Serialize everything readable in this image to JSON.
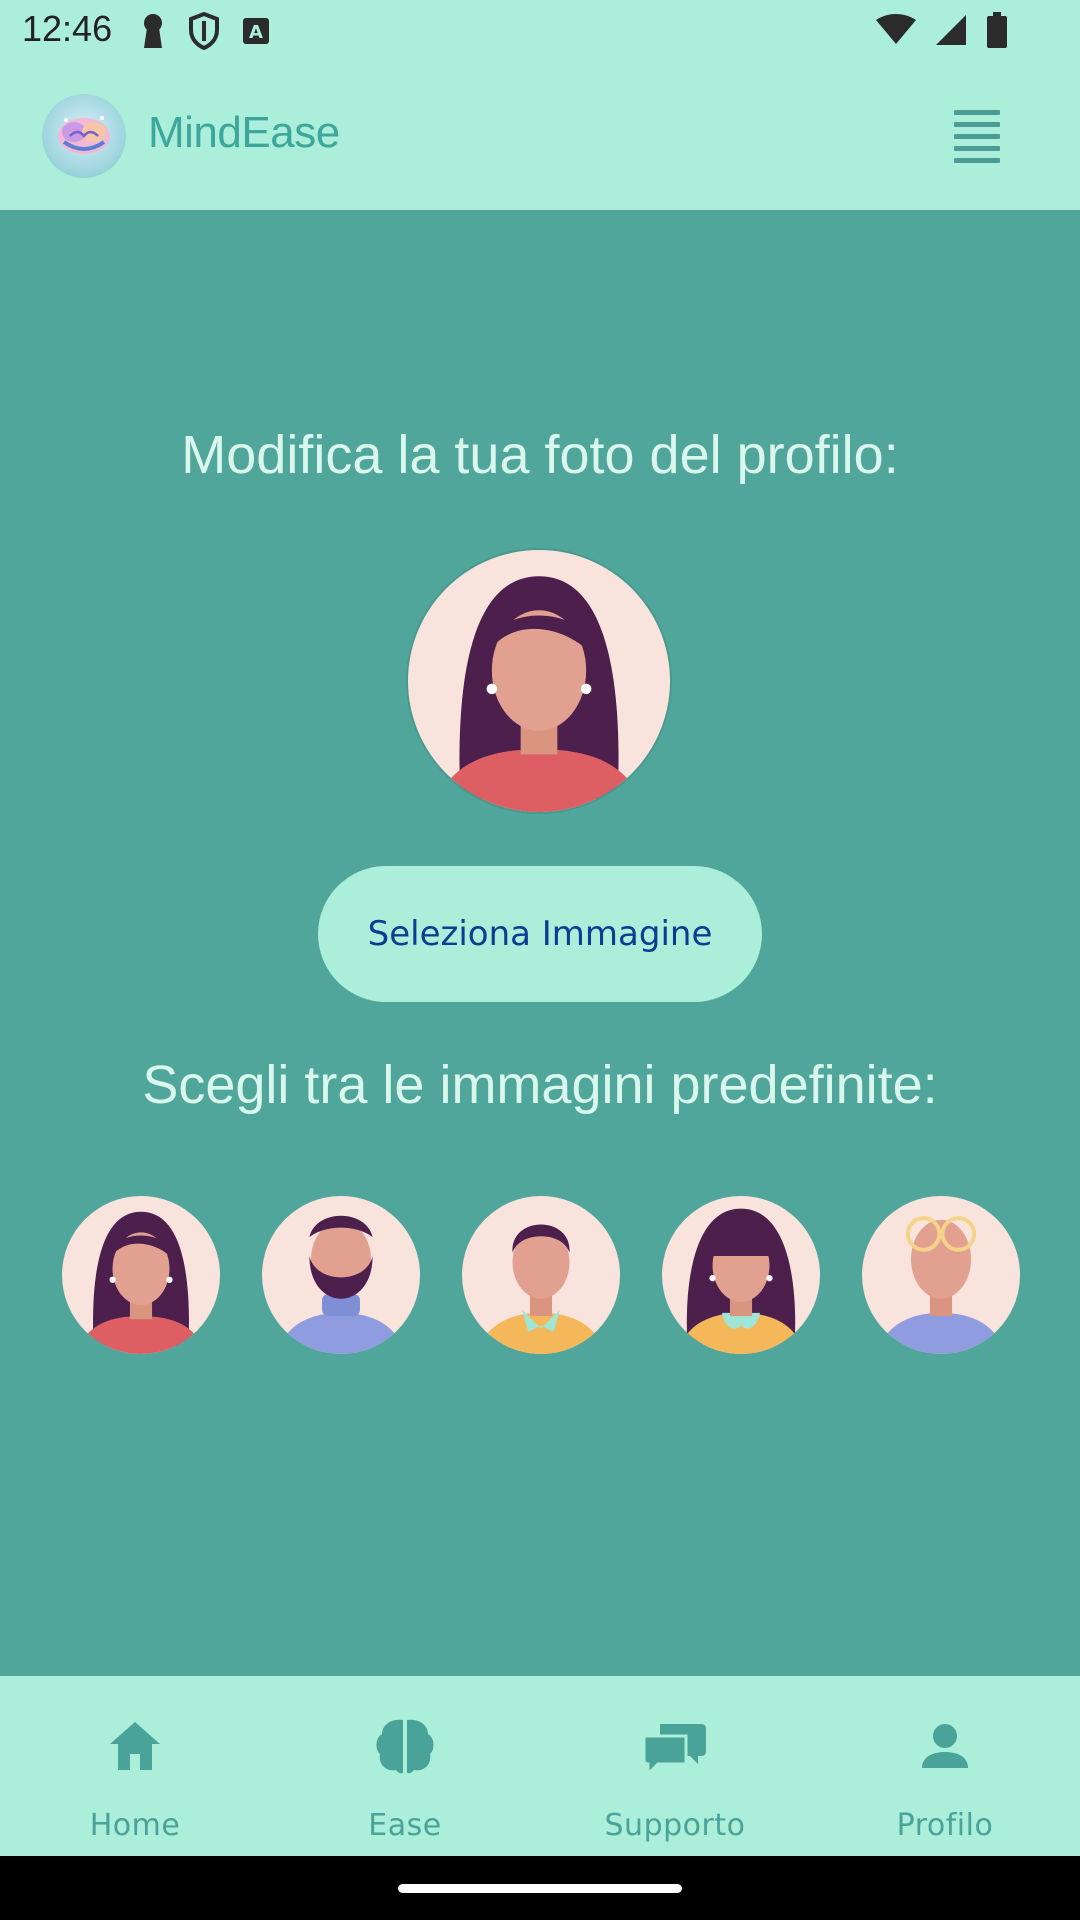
{
  "status_bar": {
    "time": "12:46",
    "left_icons": [
      "keyhole-icon",
      "shield-icon",
      "a-badge-icon"
    ],
    "right_icons": [
      "wifi-icon",
      "signal-icon",
      "battery-icon"
    ]
  },
  "app_bar": {
    "title": "MindEase",
    "logo_icon": "brain-logo-icon",
    "menu_icon": "menu-icon"
  },
  "main": {
    "heading_profile": "Modifica la tua foto del profilo:",
    "select_button_label": "Seleziona Immagine",
    "heading_presets": "Scegli tra le immagini predefinite:",
    "presets": [
      {
        "name": "woman-red-shirt"
      },
      {
        "name": "man-beard"
      },
      {
        "name": "man-yellow-collar"
      },
      {
        "name": "woman-yellow-collar"
      },
      {
        "name": "man-glasses"
      }
    ]
  },
  "bottom_nav": {
    "items": [
      {
        "label": "Home",
        "icon": "home-icon"
      },
      {
        "label": "Ease",
        "icon": "brain-icon"
      },
      {
        "label": "Supporto",
        "icon": "chat-icon"
      },
      {
        "label": "Profilo",
        "icon": "person-icon"
      }
    ]
  },
  "colors": {
    "background": "#51a69c",
    "bar": "#abeed9",
    "heading_text": "#d9f7ec",
    "button_text": "#0b3d91",
    "nav_text": "#49a398"
  }
}
